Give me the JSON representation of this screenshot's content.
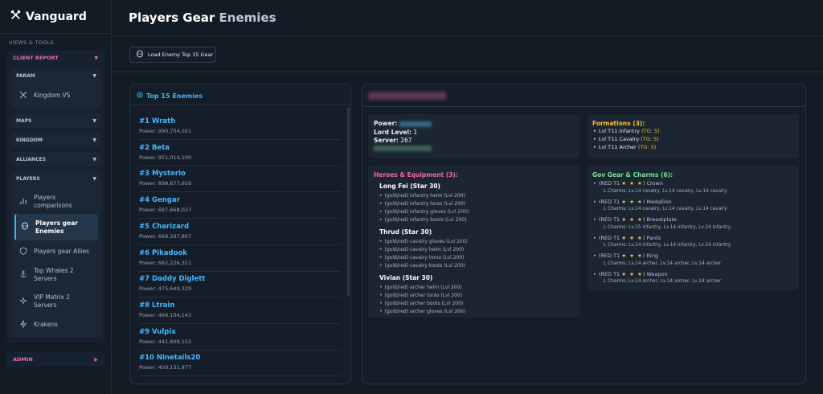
{
  "app": {
    "name": "Vanguard"
  },
  "sidebar": {
    "section_label": "VIEWS & TOOLS",
    "client_report": "CLIENT REPORT",
    "param": "PARAM",
    "kingdom_vs": "Kingdom VS",
    "maps": "MAPS",
    "kingdom": "KINGDOM",
    "alliances": "ALLIANCES",
    "players": "PLAYERS",
    "items": [
      {
        "line1": "Players",
        "line2": "comparisons"
      },
      {
        "line1": "Players gear",
        "line2": "Enemies"
      },
      {
        "line1": "Players gear Allies",
        "line2": ""
      },
      {
        "line1": "Top Whales 2",
        "line2": "Servers"
      },
      {
        "line1": "VIP Matrix 2",
        "line2": "Servers"
      },
      {
        "line1": "Krakens",
        "line2": ""
      }
    ],
    "admin": "ADMIN"
  },
  "header": {
    "title_main": "Players Gear",
    "title_accent": "Enemies"
  },
  "toolbar": {
    "load_label": "Load Enemy Top 15 Gear"
  },
  "enemies": {
    "title": "Top 15 Enemies",
    "list": [
      {
        "name": "#1 Wrath",
        "power": "Power: 990,754,021"
      },
      {
        "name": "#2 Beta",
        "power": "Power: 951,014,100"
      },
      {
        "name": "#3 Mysterio",
        "power": "Power: 898,677,659"
      },
      {
        "name": "#4 Gengar",
        "power": "Power: 697,668,027"
      },
      {
        "name": "#5 Charizard",
        "power": "Power: 668,337,807"
      },
      {
        "name": "#6 Pikadook",
        "power": "Power: 662,226,311"
      },
      {
        "name": "#7 Daddy Diglett",
        "power": "Power: 475,649,329"
      },
      {
        "name": "#8 Ltrain",
        "power": "Power: 466,104,143"
      },
      {
        "name": "#9 Vulpix",
        "power": "Power: 441,808,152"
      },
      {
        "name": "#10 Ninetails20",
        "power": "Power: 400,131,877"
      }
    ]
  },
  "detail": {
    "power_label": "Power:",
    "lord_level_label": "Lord Level:",
    "lord_level": "1",
    "server_label": "Server:",
    "server": "267",
    "formations_title": "Formations (3):",
    "formations": [
      {
        "text": "Lvl T11 Infantry",
        "tg": "(TG: 5)"
      },
      {
        "text": "Lvl T11 Cavalry",
        "tg": "(TG: 5)"
      },
      {
        "text": "Lvl T11 Archer",
        "tg": "(TG: 5)"
      }
    ],
    "heroes_title": "Heroes & Equipment (3):",
    "heroes": [
      {
        "name": "Long Fei (Star 30)",
        "gear": [
          "(gold/red) infantry helm (Lvl 200)",
          "(gold/red) infantry torso (Lvl 200)",
          "(gold/red) infantry gloves (Lvl 200)",
          "(gold/red) infantry boots (Lvl 200)"
        ]
      },
      {
        "name": "Thrud (Star 30)",
        "gear": [
          "(gold/red) cavalry gloves (Lvl 200)",
          "(gold/red) cavalry helm (Lvl 200)",
          "(gold/red) cavalry torso (Lvl 200)",
          "(gold/red) cavalry boots (Lvl 200)"
        ]
      },
      {
        "name": "Vivian (Star 30)",
        "gear": [
          "(gold/red) archer helm (Lvl 200)",
          "(gold/red) archer torso (Lvl 200)",
          "(gold/red) archer boots (Lvl 200)",
          "(gold/red) archer gloves (Lvl 200)"
        ]
      }
    ],
    "gov_title": "Gov Gear & Charms (6):",
    "gov": [
      {
        "prefix": "(RED T1",
        "stars": "★ ★ ★",
        "item": ") Crown",
        "charms": "L Charms: Lv.14 cavalry, Lv.14 cavalry, Lv.14 cavalry"
      },
      {
        "prefix": "(RED T1",
        "stars": "★ ★ ★",
        "item": ") Medallion",
        "charms": "L Charms: Lv.14 cavalry, Lv.14 cavalry, Lv.14 cavalry"
      },
      {
        "prefix": "(RED T1",
        "stars": "★ ★ ★",
        "item": ") Breastplate",
        "charms": "L Charms: Lv.15 infantry, Lv.14 infantry, Lv.14 infantry"
      },
      {
        "prefix": "(RED T1",
        "stars": "★ ★ ★",
        "item": ") Pants",
        "charms": "L Charms: Lv.14 infantry, Lv.14 infantry, Lv.14 infantry"
      },
      {
        "prefix": "(RED T1",
        "stars": "★ ★ ★",
        "item": ") Ring",
        "charms": "L Charms: Lv.14 archer, Lv.14 archer, Lv.14 archer"
      },
      {
        "prefix": "(RED T1",
        "stars": "★ ★ ★",
        "item": ") Weapon",
        "charms": "L Charms: Lv.14 archer, Lv.14 archer, Lv.14 archer"
      }
    ]
  },
  "colors": {
    "accent_blue": "#3fb5ff",
    "accent_pink": "#ec6ab0",
    "accent_yellow": "#f1c232",
    "accent_green": "#7ee08f"
  }
}
